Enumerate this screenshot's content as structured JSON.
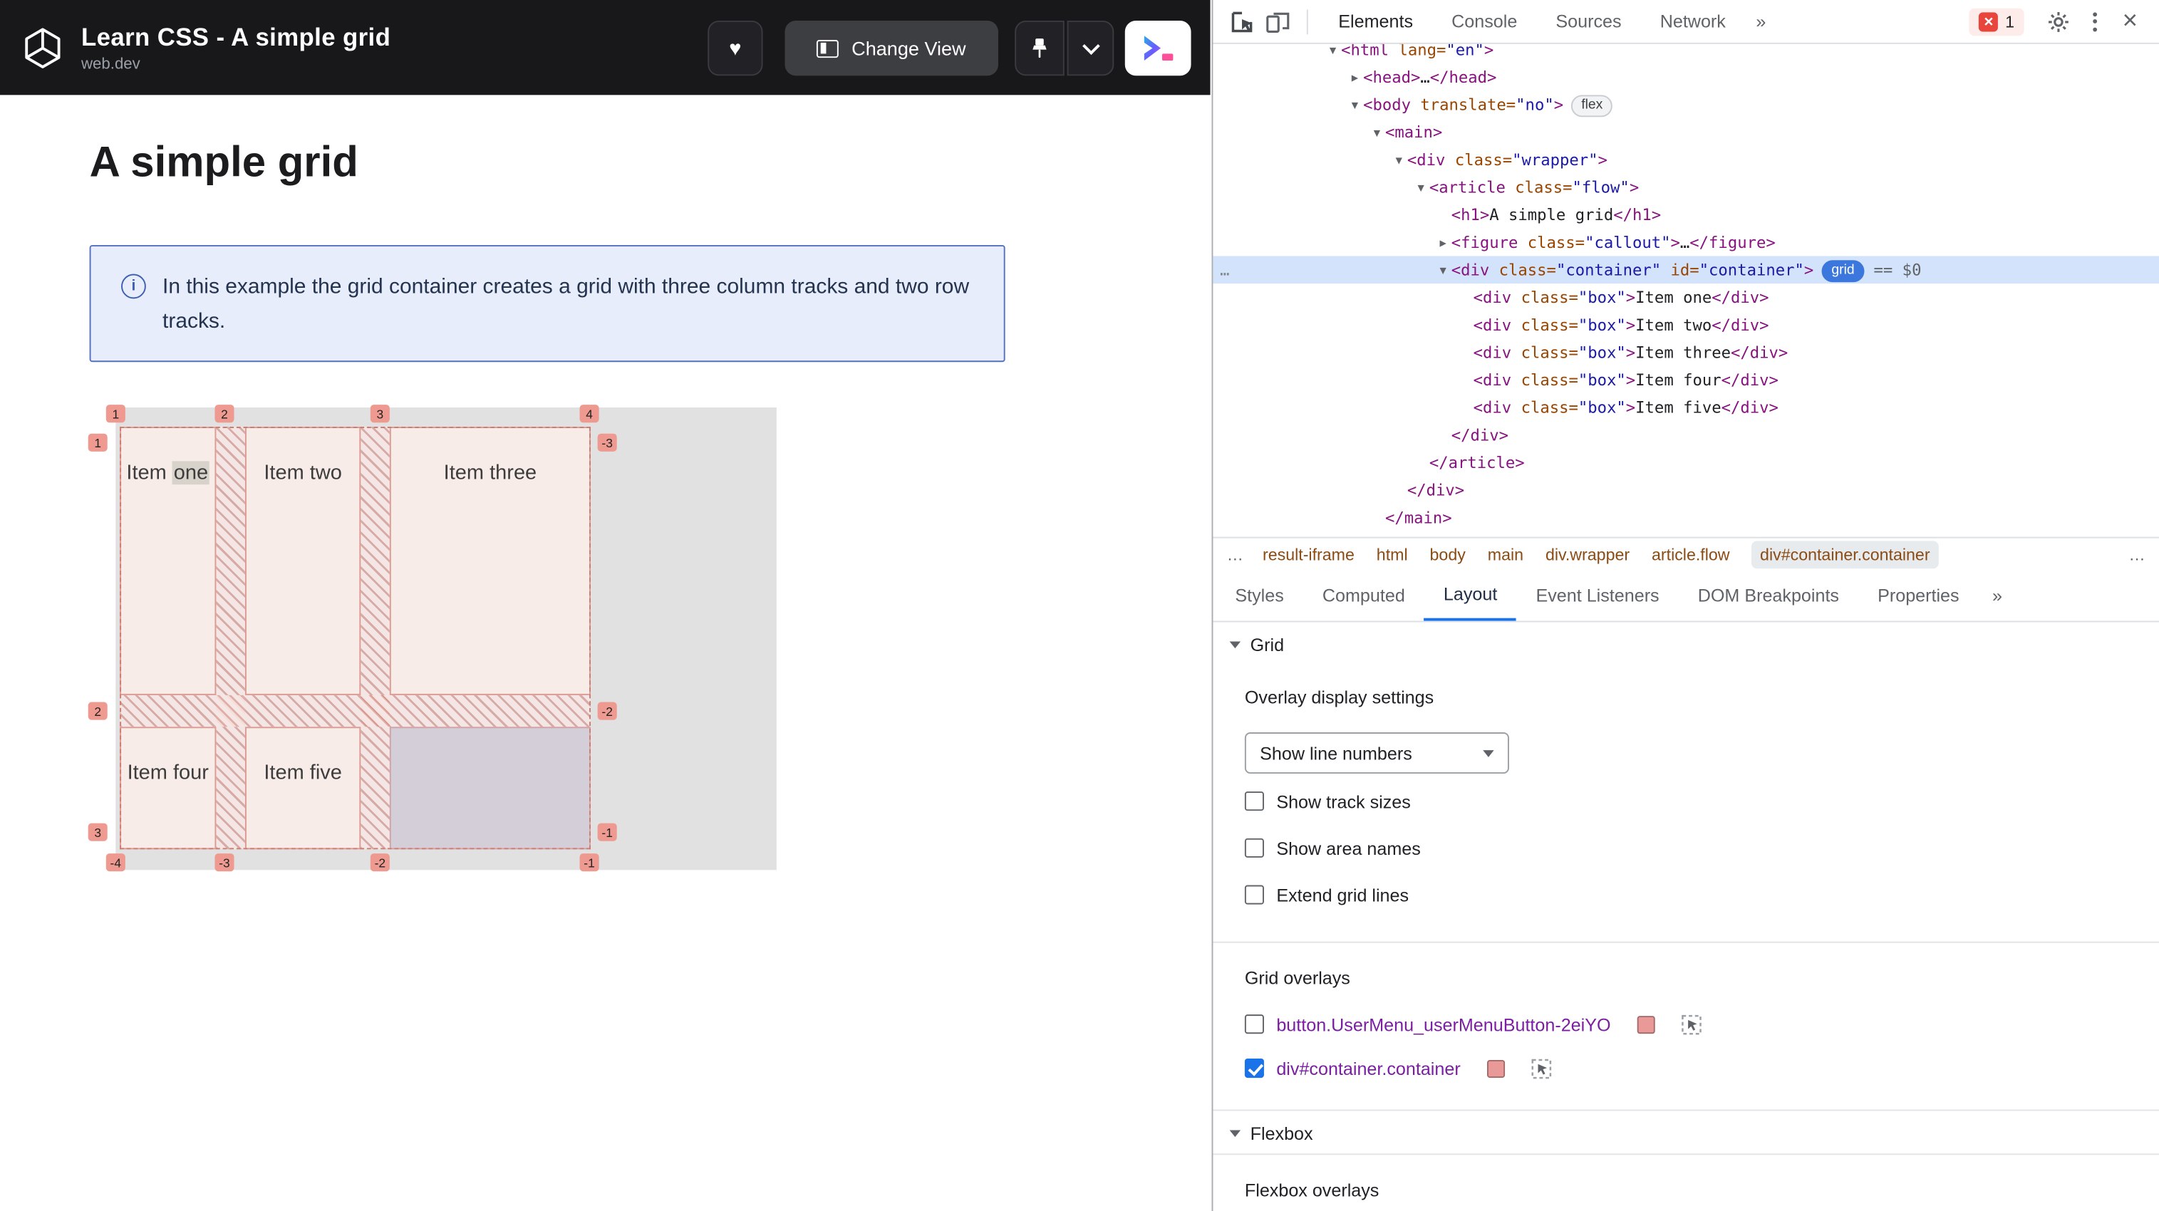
{
  "colors": {
    "accent_blue": "#1a73e8",
    "overlay_salmon": "#ea9999",
    "selected_row": "#d4e3fc",
    "badge_blue": "#3b77dd"
  },
  "page": {
    "header": {
      "title": "Learn CSS - A simple grid",
      "site": "web.dev",
      "buttons": {
        "change_view": "Change View"
      }
    },
    "heading": "A simple grid",
    "callout_text": "In this example the grid container creates a grid with three column tracks and two row tracks.",
    "grid": {
      "items": [
        {
          "label": "Item one",
          "col": 1,
          "row": 1,
          "highlight_word": "one"
        },
        {
          "label": "Item two",
          "col": 2,
          "row": 1
        },
        {
          "label": "Item three",
          "col": 3,
          "row": 1
        },
        {
          "label": "Item four",
          "col": 1,
          "row": 2
        },
        {
          "label": "Item five",
          "col": 2,
          "row": 2
        }
      ],
      "line_labels": {
        "top": [
          "1",
          "2",
          "3",
          "4"
        ],
        "bottom": [
          "-4",
          "-3",
          "-2",
          "-1"
        ],
        "left": [
          "1",
          "2",
          "3"
        ],
        "right": [
          "-3",
          "-2",
          "-1"
        ]
      }
    }
  },
  "devtools": {
    "toolbar": {
      "tabs": [
        {
          "label": "Elements",
          "active": true
        },
        {
          "label": "Console",
          "active": false
        },
        {
          "label": "Sources",
          "active": false
        },
        {
          "label": "Network",
          "active": false
        }
      ],
      "more_tabs": "»",
      "error_count": "1"
    },
    "tree": {
      "lines": [
        {
          "level": 0,
          "arrow": "open",
          "tokens": [
            [
              "tag",
              "<html"
            ],
            [
              "attr",
              " lang="
            ],
            [
              "val",
              "\"en\""
            ],
            [
              "tag",
              ">"
            ]
          ]
        },
        {
          "level": 1,
          "arrow": "closed",
          "tokens": [
            [
              "tag",
              "<head>"
            ],
            [
              "text",
              "…"
            ],
            [
              "tag",
              "</head>"
            ]
          ]
        },
        {
          "level": 1,
          "arrow": "open",
          "tokens": [
            [
              "tag",
              "<body"
            ],
            [
              "attr",
              " translate="
            ],
            [
              "val",
              "\"no\""
            ],
            [
              "tag",
              ">"
            ],
            [
              "badge",
              "flex"
            ]
          ]
        },
        {
          "level": 2,
          "arrow": "open",
          "tokens": [
            [
              "tag",
              "<main>"
            ]
          ]
        },
        {
          "level": 3,
          "arrow": "open",
          "tokens": [
            [
              "tag",
              "<div"
            ],
            [
              "attr",
              " class="
            ],
            [
              "val",
              "\"wrapper\""
            ],
            [
              "tag",
              ">"
            ]
          ]
        },
        {
          "level": 4,
          "arrow": "open",
          "tokens": [
            [
              "tag",
              "<article"
            ],
            [
              "attr",
              " class="
            ],
            [
              "val",
              "\"flow\""
            ],
            [
              "tag",
              ">"
            ]
          ]
        },
        {
          "level": 5,
          "arrow": null,
          "tokens": [
            [
              "tag",
              "<h1>"
            ],
            [
              "text",
              "A simple grid"
            ],
            [
              "tag",
              "</h1>"
            ]
          ]
        },
        {
          "level": 5,
          "arrow": "closed",
          "tokens": [
            [
              "tag",
              "<figure"
            ],
            [
              "attr",
              " class="
            ],
            [
              "val",
              "\"callout\""
            ],
            [
              "tag",
              ">"
            ],
            [
              "text",
              "…"
            ],
            [
              "tag",
              "</figure>"
            ]
          ]
        },
        {
          "level": 5,
          "arrow": "open",
          "selected": true,
          "tokens": [
            [
              "tag",
              "<div"
            ],
            [
              "attr",
              " class="
            ],
            [
              "val",
              "\"container\""
            ],
            [
              "attr",
              " id="
            ],
            [
              "val",
              "\"container\""
            ],
            [
              "tag",
              ">"
            ],
            [
              "badgeon",
              "grid"
            ],
            [
              "dim",
              "  == $0"
            ]
          ]
        },
        {
          "level": 6,
          "arrow": null,
          "tokens": [
            [
              "tag",
              "<div"
            ],
            [
              "attr",
              " class="
            ],
            [
              "val",
              "\"box\""
            ],
            [
              "tag",
              ">"
            ],
            [
              "text",
              "Item one"
            ],
            [
              "tag",
              "</div>"
            ]
          ]
        },
        {
          "level": 6,
          "arrow": null,
          "tokens": [
            [
              "tag",
              "<div"
            ],
            [
              "attr",
              " class="
            ],
            [
              "val",
              "\"box\""
            ],
            [
              "tag",
              ">"
            ],
            [
              "text",
              "Item two"
            ],
            [
              "tag",
              "</div>"
            ]
          ]
        },
        {
          "level": 6,
          "arrow": null,
          "tokens": [
            [
              "tag",
              "<div"
            ],
            [
              "attr",
              " class="
            ],
            [
              "val",
              "\"box\""
            ],
            [
              "tag",
              ">"
            ],
            [
              "text",
              "Item three"
            ],
            [
              "tag",
              "</div>"
            ]
          ]
        },
        {
          "level": 6,
          "arrow": null,
          "tokens": [
            [
              "tag",
              "<div"
            ],
            [
              "attr",
              " class="
            ],
            [
              "val",
              "\"box\""
            ],
            [
              "tag",
              ">"
            ],
            [
              "text",
              "Item four"
            ],
            [
              "tag",
              "</div>"
            ]
          ]
        },
        {
          "level": 6,
          "arrow": null,
          "tokens": [
            [
              "tag",
              "<div"
            ],
            [
              "attr",
              " class="
            ],
            [
              "val",
              "\"box\""
            ],
            [
              "tag",
              ">"
            ],
            [
              "text",
              "Item five"
            ],
            [
              "tag",
              "</div>"
            ]
          ]
        },
        {
          "level": 5,
          "arrow": null,
          "tokens": [
            [
              "tag",
              "</div>"
            ]
          ]
        },
        {
          "level": 4,
          "arrow": null,
          "tokens": [
            [
              "tag",
              "</article>"
            ]
          ]
        },
        {
          "level": 3,
          "arrow": null,
          "tokens": [
            [
              "tag",
              "</div>"
            ]
          ]
        },
        {
          "level": 2,
          "arrow": null,
          "tokens": [
            [
              "tag",
              "</main>"
            ]
          ]
        }
      ]
    },
    "breadcrumbs": {
      "leading_ellipsis": "…",
      "items": [
        "result-iframe",
        "html",
        "body",
        "main",
        "div.wrapper",
        "article.flow"
      ],
      "selected": "div#container.container",
      "trailing_ellipsis": "…"
    },
    "panel_tabs": [
      {
        "label": "Styles",
        "active": false
      },
      {
        "label": "Computed",
        "active": false
      },
      {
        "label": "Layout",
        "active": true
      },
      {
        "label": "Event Listeners",
        "active": false
      },
      {
        "label": "DOM Breakpoints",
        "active": false
      },
      {
        "label": "Properties",
        "active": false
      }
    ],
    "panel_tabs_more": "»",
    "layout": {
      "grid_section_title": "Grid",
      "overlay_settings_title": "Overlay display settings",
      "line_numbers_select": "Show line numbers",
      "checkboxes": [
        {
          "label": "Show track sizes",
          "checked": false
        },
        {
          "label": "Show area names",
          "checked": false
        },
        {
          "label": "Extend grid lines",
          "checked": false
        }
      ],
      "grid_overlays_title": "Grid overlays",
      "grid_overlays": [
        {
          "label": "button.UserMenu_userMenuButton-2eiYO",
          "checked": false,
          "color": "#ea9999"
        },
        {
          "label": "div#container.container",
          "checked": true,
          "color": "#ea9999"
        }
      ],
      "flexbox_section_title": "Flexbox",
      "flexbox_overlays_title": "Flexbox overlays"
    }
  }
}
